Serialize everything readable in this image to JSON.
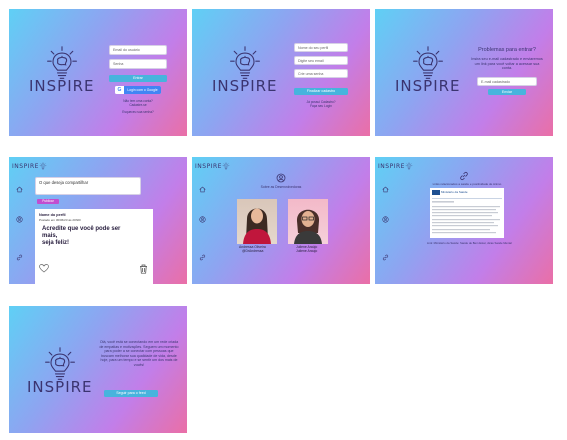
{
  "login": {
    "logo_text": "INSPIRE",
    "username_placeholder": "Email do usuário",
    "password_placeholder": "Senha",
    "submit_label": "Entrar",
    "google_label": "Login com o Google",
    "no_account": "Não tem uma conta?",
    "register_link": "Cadastre-se",
    "forgot_link": "Esqueceu sua senha?"
  },
  "register": {
    "logo_text": "INSPIRE",
    "name_placeholder": "Nome do seu perfil",
    "email_placeholder": "Digite seu email",
    "password_placeholder": "Crie uma senha",
    "submit_label": "Finalizar cadastro",
    "has_account": "Já possui Cadastro?",
    "login_link": "Faça seu Login"
  },
  "recover": {
    "logo_text": "INSPIRE",
    "title": "Problemas para entrar?",
    "text": "Insira seu e-mail cadastrado e enviaremos um link para você voltar a acessar sua conta.",
    "email_placeholder": "E-mail cadastrado",
    "submit_label": "Enviar"
  },
  "feed": {
    "brand": "INSPIRE",
    "compose_placeholder": "O que deseja compartilhar",
    "publish_label": "Publicar",
    "post_author": "Nome do perfil",
    "post_date": "Postado em 30/06/23 às 20h00",
    "post_text_line1": "Acredite que você  pode ser",
    "post_text_line2": "mais,",
    "post_text_line3": "seja feliz!"
  },
  "about": {
    "brand": "INSPIRE",
    "title": "Sobre as Desenvolvedoras",
    "dev1_name": "Andressa Oliveira",
    "dev1_handle": "@DrAndressa",
    "dev2_name": "Juliene Araújo",
    "dev2_handle": "Juliene Araujo"
  },
  "links": {
    "brand": "INSPIRE",
    "title": "Links relacionados a saúde e positividade de ânimo",
    "article_header": "Ministério da Saúde",
    "caption": "Link: Ministério da Saúde: Saúde de Bem Estar, dicas Saúde Mental"
  },
  "welcome": {
    "logo_text": "INSPIRE",
    "text": "Olá, você está se conectando em um rede criada de empatias e motivações. Seguem um momento para poder a se conectar com pessoas que buscam melhorar sua qualidade de vida, desde hoje, para um tempo e se sentir um dos mais de vocês!",
    "submit_label": "Seguir para o feed"
  },
  "colors": {
    "gradient_start": "#5fd0f5",
    "gradient_end": "#ea6fa6",
    "button_blue": "#47b4dd",
    "button_purple": "#c14ed0",
    "logo_ink": "#3b3470"
  }
}
